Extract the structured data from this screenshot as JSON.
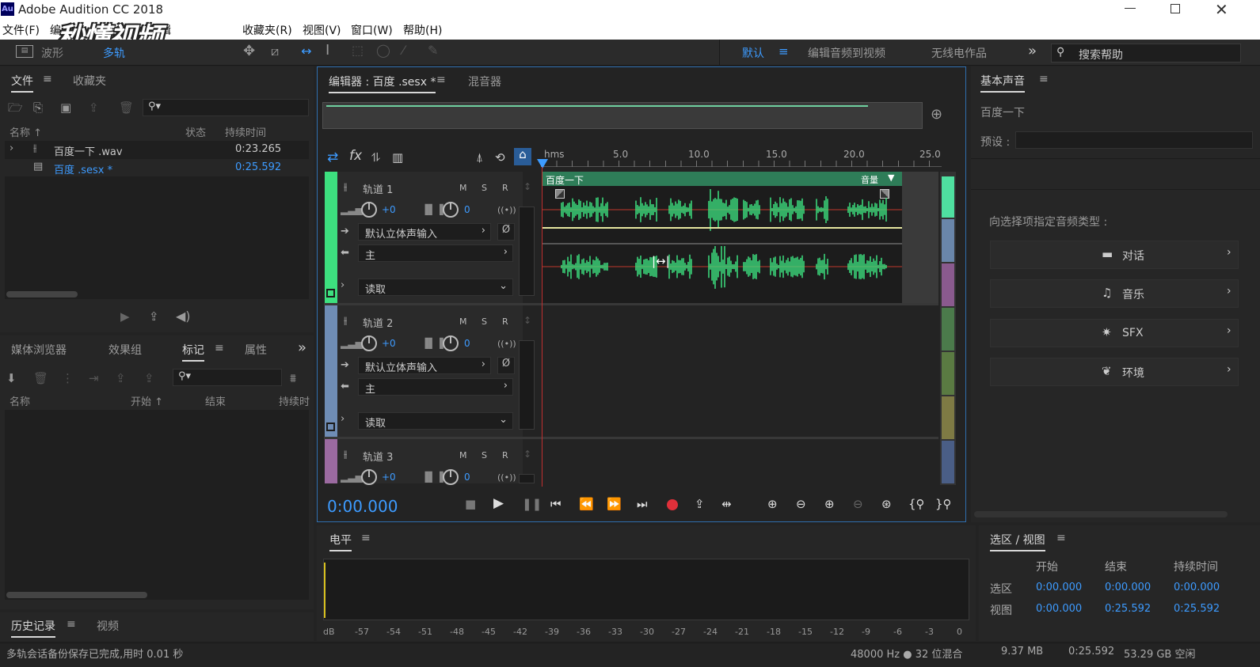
{
  "app": {
    "title": "Adobe Audition CC 2018",
    "logo": "Au"
  },
  "watermark": "秒懂视频",
  "menu": [
    "文件(F)",
    "编",
    "剪辑",
    "收藏夹(R)",
    "视图(V)",
    "窗口(W)",
    "帮助(H)"
  ],
  "toolbar": {
    "waveform_label": "波形",
    "multitrack_label": "多轨",
    "workspaces": [
      "默认",
      "编辑音频到视频",
      "无线电作品"
    ],
    "search_placeholder": "搜索帮助"
  },
  "files_panel": {
    "tabs": [
      "文件",
      "收藏夹"
    ],
    "columns": [
      "名称 ↑",
      "状态",
      "持续时间"
    ],
    "rows": [
      {
        "name": "百度一下 .wav",
        "status": "",
        "duration": "0:23.265"
      },
      {
        "name": "百度 .sesx *",
        "status": "",
        "duration": "0:25.592"
      }
    ]
  },
  "markers_panel": {
    "tabs": [
      "媒体浏览器",
      "效果组",
      "标记",
      "属性"
    ],
    "columns": [
      "名称",
      "开始 ↑",
      "结束",
      "持续时"
    ]
  },
  "history_panel": {
    "tabs": [
      "历史记录",
      "视频"
    ]
  },
  "editor": {
    "tabs": [
      "编辑器 : 百度 .sesx *",
      "混音器"
    ],
    "ruler": [
      "hms",
      "5.0",
      "10.0",
      "15.0",
      "20.0",
      "25.0"
    ],
    "clip": {
      "name": "百度一下",
      "volume_label": "音量"
    },
    "tracks": [
      {
        "name": "轨道 1",
        "volume": "+0",
        "pan": "0",
        "input": "默认立体声输入",
        "output": "主",
        "automation": "读取",
        "color": "#3de07f"
      },
      {
        "name": "轨道 2",
        "volume": "+0",
        "pan": "0",
        "input": "默认立体声输入",
        "output": "主",
        "automation": "读取",
        "color": "#6f8db5"
      },
      {
        "name": "轨道 3",
        "volume": "+0",
        "pan": "0",
        "color": "#9b6aa0"
      }
    ],
    "msr": [
      "M",
      "S",
      "R"
    ],
    "time": "0:00.000"
  },
  "levels_panel": {
    "title": "电平",
    "scale": [
      "dB",
      "-57",
      "-54",
      "-51",
      "-48",
      "-45",
      "-42",
      "-39",
      "-36",
      "-33",
      "-30",
      "-27",
      "-24",
      "-21",
      "-18",
      "-15",
      "-12",
      "-9",
      "-6",
      "-3",
      "0"
    ]
  },
  "essential_sound": {
    "title": "基本声音",
    "clip_name": "百度一下",
    "preset_label": "预设 :",
    "prompt": "向选择项指定音频类型 :",
    "types": [
      "对话",
      "音乐",
      "SFX",
      "环境"
    ]
  },
  "selection_view": {
    "title": "选区 / 视图",
    "columns": [
      "开始",
      "结束",
      "持续时间"
    ],
    "rows": [
      {
        "label": "选区",
        "start": "0:00.000",
        "end": "0:00.000",
        "duration": "0:00.000"
      },
      {
        "label": "视图",
        "start": "0:00.000",
        "end": "0:25.592",
        "duration": "0:25.592"
      }
    ]
  },
  "status": {
    "message": "多轨会话备份保存已完成,用时 0.01 秒",
    "format": "48000 Hz ● 32 位混合",
    "size": "9.37 MB",
    "duration": "0:25.592",
    "free": "53.29 GB 空闲"
  },
  "colors": {
    "accent": "#3d9bff",
    "waveform": "#3de07f",
    "record": "#e0303a"
  }
}
